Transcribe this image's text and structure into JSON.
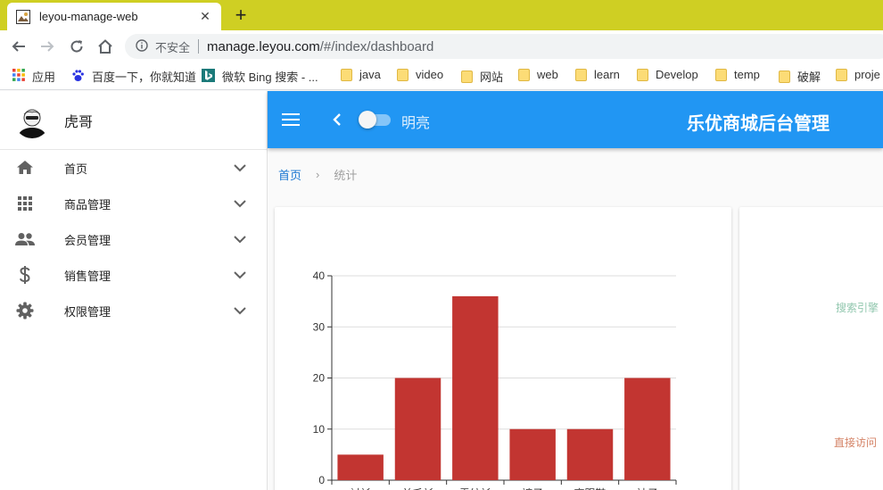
{
  "browser": {
    "tab_title": "leyou-manage-web",
    "tab_close": "✕",
    "new_tab": "+",
    "insecure_label": "不安全",
    "url_host": "manage.leyou.com",
    "url_path": "/#/index/dashboard",
    "bookmarks": [
      {
        "label": "应用",
        "icon": "apps-grid-icon"
      },
      {
        "label": "百度一下，你就知道",
        "icon": "baidu-paw-icon"
      },
      {
        "label": "微软 Bing 搜索 - ...",
        "icon": "bing-icon"
      },
      {
        "label": "java",
        "icon": "folder-icon"
      },
      {
        "label": "video",
        "icon": "folder-icon"
      },
      {
        "label": "网站",
        "icon": "folder-icon"
      },
      {
        "label": "web",
        "icon": "folder-icon"
      },
      {
        "label": "learn",
        "icon": "folder-icon"
      },
      {
        "label": "Develop",
        "icon": "folder-icon"
      },
      {
        "label": "temp",
        "icon": "folder-icon"
      },
      {
        "label": "破解",
        "icon": "folder-icon"
      },
      {
        "label": "proje",
        "icon": "folder-icon"
      }
    ]
  },
  "sidebar": {
    "user_name": "虎哥",
    "items": [
      {
        "label": "首页",
        "icon": "home-icon"
      },
      {
        "label": "商品管理",
        "icon": "apps-icon"
      },
      {
        "label": "会员管理",
        "icon": "people-icon"
      },
      {
        "label": "销售管理",
        "icon": "dollar-icon"
      },
      {
        "label": "权限管理",
        "icon": "settings-icon"
      }
    ]
  },
  "appbar": {
    "theme_label": "明亮",
    "title": "乐优商城后台管理",
    "color": "#2196f3"
  },
  "breadcrumbs": {
    "home": "首页",
    "separator": "›",
    "current": "统计"
  },
  "chart_data": [
    {
      "type": "bar",
      "categories": [
        "衬衫",
        "羊毛衫",
        "雪纺衫",
        "裤子",
        "高跟鞋",
        "袜子"
      ],
      "values": [
        5,
        20,
        36,
        10,
        10,
        20
      ],
      "ylim": [
        0,
        40
      ],
      "yticks": [
        0,
        10,
        20,
        30,
        40
      ],
      "grid": true,
      "bar_color": "#c23531"
    },
    {
      "type": "pie",
      "labels": [
        "搜索引擎",
        "直接访问"
      ],
      "label_colors": [
        "#91c7ae",
        "#d48265"
      ]
    }
  ]
}
